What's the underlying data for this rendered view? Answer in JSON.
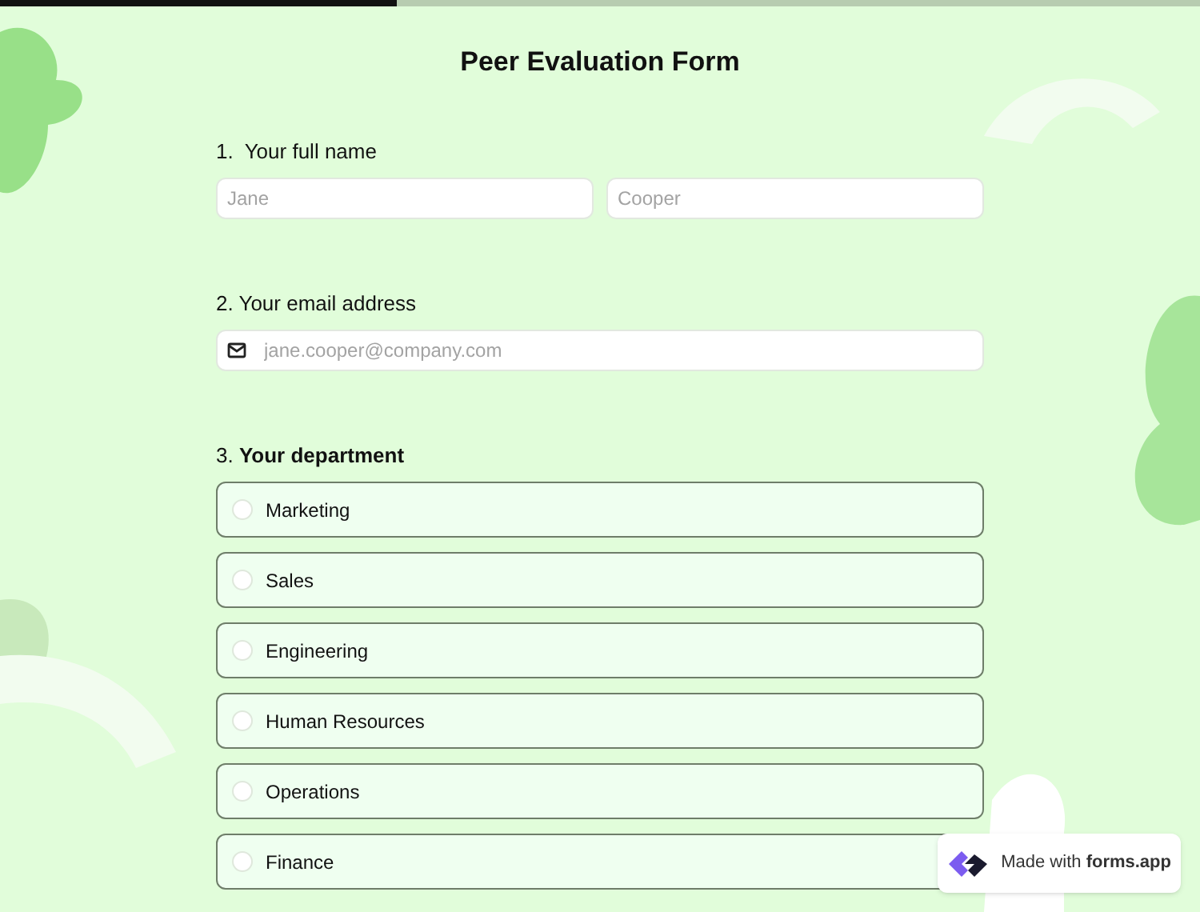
{
  "progress": {
    "level": 0.33
  },
  "title": "Peer Evaluation Form",
  "questions": [
    {
      "kind": "name",
      "label": "1.  Your full name",
      "fields": [
        {
          "placeholder": "Jane"
        },
        {
          "placeholder": "Cooper"
        }
      ]
    },
    {
      "kind": "email",
      "label": "2. Your email address",
      "fields": [
        {
          "placeholder": "jane.cooper@company.com"
        }
      ]
    },
    {
      "kind": "choice",
      "label": "3. **Your department**",
      "options": [
        {
          "label": "Marketing",
          "selected": false
        },
        {
          "label": "Sales",
          "selected": false
        },
        {
          "label": "Engineering",
          "selected": false
        },
        {
          "label": "Human Resources",
          "selected": false
        },
        {
          "label": "Operations",
          "selected": false
        },
        {
          "label": "Finance",
          "selected": false
        }
      ]
    }
  ],
  "badge": {
    "text": "Made with **forms.app**"
  }
}
